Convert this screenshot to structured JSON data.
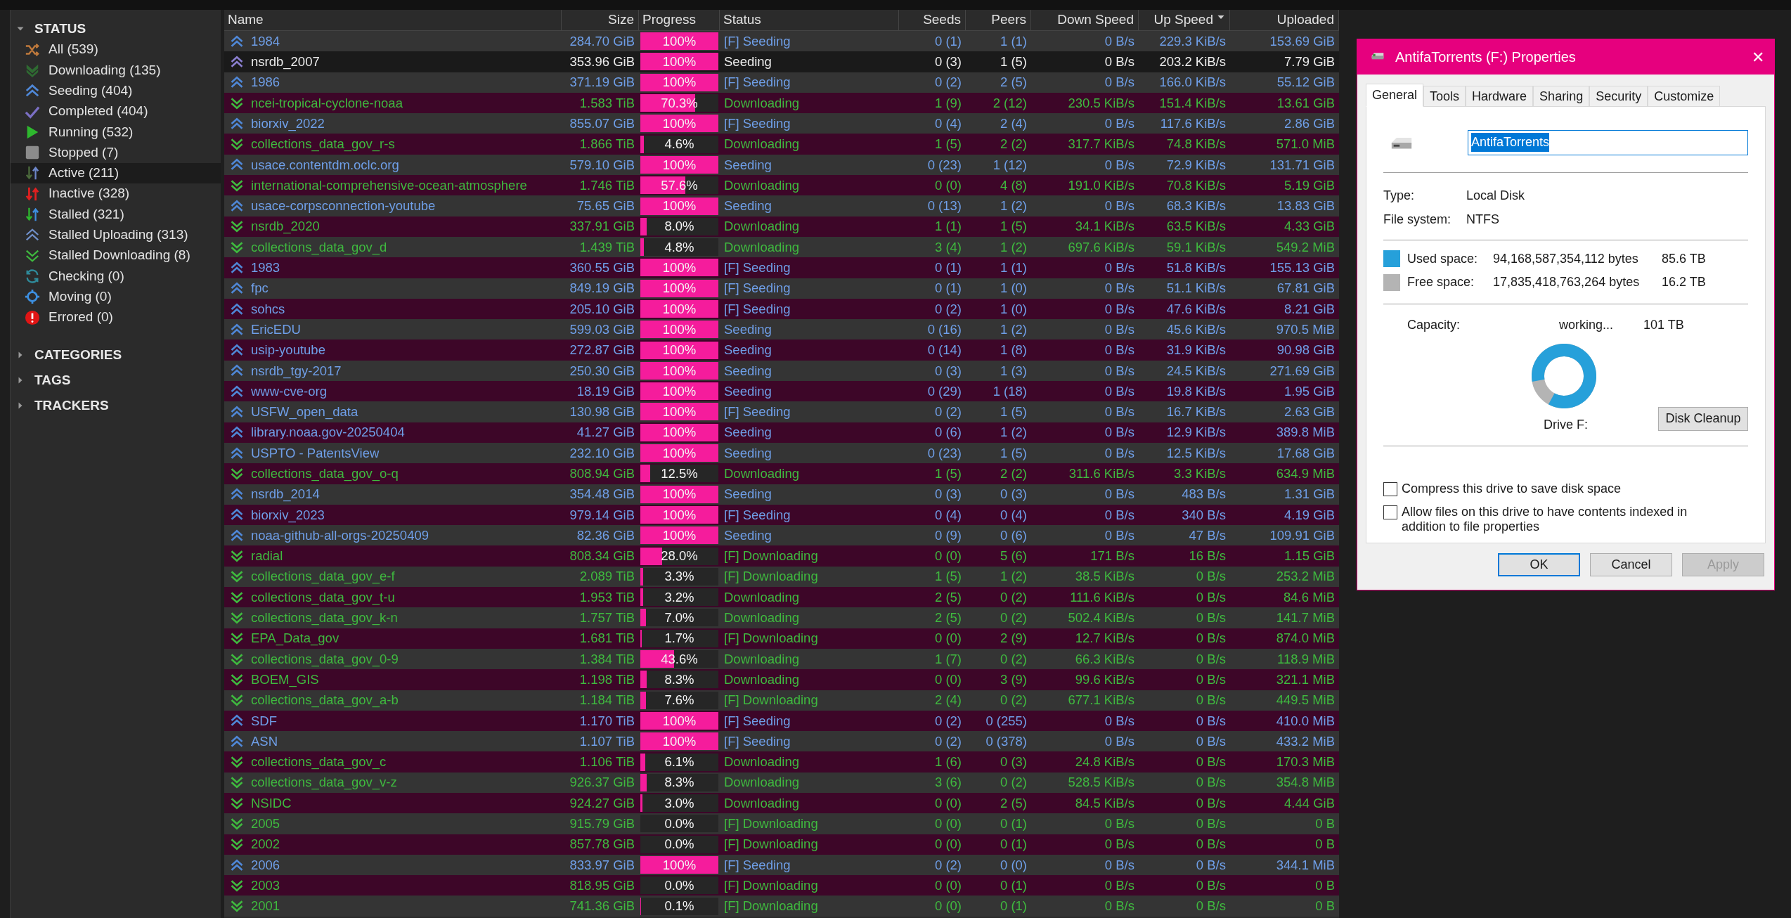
{
  "sidebar": {
    "sections": [
      {
        "label": "STATUS",
        "expanded": true,
        "items": [
          {
            "kind": "all",
            "label": "All (539)",
            "selected": false
          },
          {
            "kind": "downloading",
            "label": "Downloading (135)",
            "selected": false
          },
          {
            "kind": "seeding",
            "label": "Seeding (404)",
            "selected": false
          },
          {
            "kind": "completed",
            "label": "Completed (404)",
            "selected": false
          },
          {
            "kind": "running",
            "label": "Running (532)",
            "selected": false
          },
          {
            "kind": "stopped",
            "label": "Stopped (7)",
            "selected": false
          },
          {
            "kind": "active",
            "label": "Active (211)",
            "selected": true
          },
          {
            "kind": "inactive",
            "label": "Inactive (328)",
            "selected": false
          },
          {
            "kind": "stalled",
            "label": "Stalled (321)",
            "selected": false
          },
          {
            "kind": "stalled-uploading",
            "label": "Stalled Uploading (313)",
            "selected": false
          },
          {
            "kind": "stalled-downloading",
            "label": "Stalled Downloading (8)",
            "selected": false
          },
          {
            "kind": "checking",
            "label": "Checking (0)",
            "selected": false
          },
          {
            "kind": "moving",
            "label": "Moving (0)",
            "selected": false
          },
          {
            "kind": "errored",
            "label": "Errored (0)",
            "selected": false
          }
        ]
      },
      {
        "label": "CATEGORIES",
        "expanded": false
      },
      {
        "label": "TAGS",
        "expanded": false
      },
      {
        "label": "TRACKERS",
        "expanded": false
      }
    ]
  },
  "table": {
    "columns": [
      {
        "label": "Name",
        "sorted": false
      },
      {
        "label": "Size",
        "sorted": false
      },
      {
        "label": "Progress",
        "sorted": false
      },
      {
        "label": "Status",
        "sorted": false
      },
      {
        "label": "Seeds",
        "sorted": false
      },
      {
        "label": "Peers",
        "sorted": false
      },
      {
        "label": "Down Speed",
        "sorted": false
      },
      {
        "label": "Up Speed",
        "sorted": true
      },
      {
        "label": "Uploaded",
        "sorted": false
      }
    ],
    "rows": [
      {
        "kind": "seeding",
        "selected": false,
        "name": "1984",
        "size": "284.70 GiB",
        "progress": "100%",
        "level": 1,
        "status": "[F] Seeding",
        "seeds": "0 (1)",
        "peers": "1 (1)",
        "down_speed": "0 B/s",
        "up_speed": "229.3 KiB/s",
        "uploaded": "153.69 GiB"
      },
      {
        "kind": "seeding",
        "selected": true,
        "name": "nsrdb_2007",
        "size": "353.96 GiB",
        "progress": "100%",
        "level": 1,
        "status": "Seeding",
        "seeds": "0 (3)",
        "peers": "1 (5)",
        "down_speed": "0 B/s",
        "up_speed": "203.2 KiB/s",
        "uploaded": "7.79 GiB"
      },
      {
        "kind": "seeding",
        "selected": false,
        "name": "1986",
        "size": "371.19 GiB",
        "progress": "100%",
        "level": 1,
        "status": "[F] Seeding",
        "seeds": "0 (2)",
        "peers": "2 (5)",
        "down_speed": "0 B/s",
        "up_speed": "166.0 KiB/s",
        "uploaded": "55.12 GiB"
      },
      {
        "kind": "downloading",
        "selected": false,
        "name": "ncei-tropical-cyclone-noaa",
        "size": "1.583 TiB",
        "progress": "70.3%",
        "level": 0.703,
        "status": "Downloading",
        "seeds": "1 (9)",
        "peers": "2 (12)",
        "down_speed": "230.5 KiB/s",
        "up_speed": "151.4 KiB/s",
        "uploaded": "13.61 GiB"
      },
      {
        "kind": "seeding",
        "selected": false,
        "name": "biorxiv_2022",
        "size": "855.07 GiB",
        "progress": "100%",
        "level": 1,
        "status": "[F] Seeding",
        "seeds": "0 (4)",
        "peers": "2 (4)",
        "down_speed": "0 B/s",
        "up_speed": "117.6 KiB/s",
        "uploaded": "2.86 GiB"
      },
      {
        "kind": "downloading",
        "selected": false,
        "name": "collections_data_gov_r-s",
        "size": "1.866 TiB",
        "progress": "4.6%",
        "level": 0.046,
        "status": "Downloading",
        "seeds": "1 (5)",
        "peers": "2 (2)",
        "down_speed": "317.7 KiB/s",
        "up_speed": "74.8 KiB/s",
        "uploaded": "571.0 MiB"
      },
      {
        "kind": "seeding",
        "selected": false,
        "name": "usace.contentdm.oclc.org",
        "size": "579.10 GiB",
        "progress": "100%",
        "level": 1,
        "status": "Seeding",
        "seeds": "0 (23)",
        "peers": "1 (12)",
        "down_speed": "0 B/s",
        "up_speed": "72.9 KiB/s",
        "uploaded": "131.71 GiB"
      },
      {
        "kind": "downloading",
        "selected": false,
        "name": "international-comprehensive-ocean-atmosphere",
        "size": "1.746 TiB",
        "progress": "57.6%",
        "level": 0.576,
        "status": "Downloading",
        "seeds": "0 (0)",
        "peers": "4 (8)",
        "down_speed": "191.0 KiB/s",
        "up_speed": "70.8 KiB/s",
        "uploaded": "5.19 GiB"
      },
      {
        "kind": "seeding",
        "selected": false,
        "name": "usace-corpsconnection-youtube",
        "size": "75.65 GiB",
        "progress": "100%",
        "level": 1,
        "status": "Seeding",
        "seeds": "0 (13)",
        "peers": "1 (2)",
        "down_speed": "0 B/s",
        "up_speed": "68.3 KiB/s",
        "uploaded": "13.83 GiB"
      },
      {
        "kind": "downloading",
        "selected": false,
        "name": "nsrdb_2020",
        "size": "337.91 GiB",
        "progress": "8.0%",
        "level": 0.08,
        "status": "Downloading",
        "seeds": "1 (1)",
        "peers": "1 (5)",
        "down_speed": "34.1 KiB/s",
        "up_speed": "63.5 KiB/s",
        "uploaded": "4.33 GiB"
      },
      {
        "kind": "downloading",
        "selected": false,
        "name": "collections_data_gov_d",
        "size": "1.439 TiB",
        "progress": "4.8%",
        "level": 0.048,
        "status": "Downloading",
        "seeds": "3 (4)",
        "peers": "1 (2)",
        "down_speed": "697.6 KiB/s",
        "up_speed": "59.1 KiB/s",
        "uploaded": "549.2 MiB"
      },
      {
        "kind": "seeding",
        "selected": false,
        "name": "1983",
        "size": "360.55 GiB",
        "progress": "100%",
        "level": 1,
        "status": "[F] Seeding",
        "seeds": "0 (1)",
        "peers": "1 (1)",
        "down_speed": "0 B/s",
        "up_speed": "51.8 KiB/s",
        "uploaded": "155.13 GiB"
      },
      {
        "kind": "seeding",
        "selected": false,
        "name": "fpc",
        "size": "849.19 GiB",
        "progress": "100%",
        "level": 1,
        "status": "[F] Seeding",
        "seeds": "0 (1)",
        "peers": "1 (0)",
        "down_speed": "0 B/s",
        "up_speed": "51.1 KiB/s",
        "uploaded": "67.81 GiB"
      },
      {
        "kind": "seeding",
        "selected": false,
        "name": "sohcs",
        "size": "205.10 GiB",
        "progress": "100%",
        "level": 1,
        "status": "[F] Seeding",
        "seeds": "0 (2)",
        "peers": "1 (0)",
        "down_speed": "0 B/s",
        "up_speed": "47.6 KiB/s",
        "uploaded": "8.21 GiB"
      },
      {
        "kind": "seeding",
        "selected": false,
        "name": "EricEDU",
        "size": "599.03 GiB",
        "progress": "100%",
        "level": 1,
        "status": "Seeding",
        "seeds": "0 (16)",
        "peers": "1 (2)",
        "down_speed": "0 B/s",
        "up_speed": "45.6 KiB/s",
        "uploaded": "970.5 MiB"
      },
      {
        "kind": "seeding",
        "selected": false,
        "name": "usip-youtube",
        "size": "272.87 GiB",
        "progress": "100%",
        "level": 1,
        "status": "Seeding",
        "seeds": "0 (14)",
        "peers": "1 (8)",
        "down_speed": "0 B/s",
        "up_speed": "31.9 KiB/s",
        "uploaded": "90.98 GiB"
      },
      {
        "kind": "seeding",
        "selected": false,
        "name": "nsrdb_tgy-2017",
        "size": "250.30 GiB",
        "progress": "100%",
        "level": 1,
        "status": "Seeding",
        "seeds": "0 (3)",
        "peers": "1 (3)",
        "down_speed": "0 B/s",
        "up_speed": "24.5 KiB/s",
        "uploaded": "271.69 GiB"
      },
      {
        "kind": "seeding",
        "selected": false,
        "name": "www-cve-org",
        "size": "18.19 GiB",
        "progress": "100%",
        "level": 1,
        "status": "Seeding",
        "seeds": "0 (29)",
        "peers": "1 (18)",
        "down_speed": "0 B/s",
        "up_speed": "19.8 KiB/s",
        "uploaded": "1.95 GiB"
      },
      {
        "kind": "seeding",
        "selected": false,
        "name": "USFW_open_data",
        "size": "130.98 GiB",
        "progress": "100%",
        "level": 1,
        "status": "[F] Seeding",
        "seeds": "0 (2)",
        "peers": "1 (5)",
        "down_speed": "0 B/s",
        "up_speed": "16.7 KiB/s",
        "uploaded": "2.63 GiB"
      },
      {
        "kind": "seeding",
        "selected": false,
        "name": "library.noaa.gov-20250404",
        "size": "41.27 GiB",
        "progress": "100%",
        "level": 1,
        "status": "Seeding",
        "seeds": "0 (6)",
        "peers": "1 (2)",
        "down_speed": "0 B/s",
        "up_speed": "12.9 KiB/s",
        "uploaded": "389.8 MiB"
      },
      {
        "kind": "seeding",
        "selected": false,
        "name": "USPTO - PatentsView",
        "size": "232.10 GiB",
        "progress": "100%",
        "level": 1,
        "status": "Seeding",
        "seeds": "0 (23)",
        "peers": "1 (5)",
        "down_speed": "0 B/s",
        "up_speed": "12.5 KiB/s",
        "uploaded": "17.68 GiB"
      },
      {
        "kind": "downloading",
        "selected": false,
        "name": "collections_data_gov_o-q",
        "size": "808.94 GiB",
        "progress": "12.5%",
        "level": 0.125,
        "status": "Downloading",
        "seeds": "1 (5)",
        "peers": "2 (2)",
        "down_speed": "311.6 KiB/s",
        "up_speed": "3.3 KiB/s",
        "uploaded": "634.9 MiB"
      },
      {
        "kind": "seeding",
        "selected": false,
        "name": "nsrdb_2014",
        "size": "354.48 GiB",
        "progress": "100%",
        "level": 1,
        "status": "Seeding",
        "seeds": "0 (3)",
        "peers": "0 (3)",
        "down_speed": "0 B/s",
        "up_speed": "483 B/s",
        "uploaded": "1.31 GiB"
      },
      {
        "kind": "seeding",
        "selected": false,
        "name": "biorxiv_2023",
        "size": "979.14 GiB",
        "progress": "100%",
        "level": 1,
        "status": "[F] Seeding",
        "seeds": "0 (4)",
        "peers": "0 (4)",
        "down_speed": "0 B/s",
        "up_speed": "340 B/s",
        "uploaded": "4.19 GiB"
      },
      {
        "kind": "seeding",
        "selected": false,
        "name": "noaa-github-all-orgs-20250409",
        "size": "82.36 GiB",
        "progress": "100%",
        "level": 1,
        "status": "Seeding",
        "seeds": "0 (9)",
        "peers": "0 (6)",
        "down_speed": "0 B/s",
        "up_speed": "47 B/s",
        "uploaded": "109.91 GiB"
      },
      {
        "kind": "downloading",
        "selected": false,
        "name": "radial",
        "size": "808.34 GiB",
        "progress": "28.0%",
        "level": 0.28,
        "status": "[F] Downloading",
        "seeds": "0 (0)",
        "peers": "5 (6)",
        "down_speed": "171 B/s",
        "up_speed": "16 B/s",
        "uploaded": "1.15 GiB"
      },
      {
        "kind": "downloading",
        "selected": false,
        "name": "collections_data_gov_e-f",
        "size": "2.089 TiB",
        "progress": "3.3%",
        "level": 0.033,
        "status": "[F] Downloading",
        "seeds": "1 (5)",
        "peers": "1 (2)",
        "down_speed": "38.5 KiB/s",
        "up_speed": "0 B/s",
        "uploaded": "253.2 MiB"
      },
      {
        "kind": "downloading",
        "selected": false,
        "name": "collections_data_gov_t-u",
        "size": "1.953 TiB",
        "progress": "3.2%",
        "level": 0.032,
        "status": "Downloading",
        "seeds": "2 (5)",
        "peers": "0 (2)",
        "down_speed": "111.6 KiB/s",
        "up_speed": "0 B/s",
        "uploaded": "84.6 MiB"
      },
      {
        "kind": "downloading",
        "selected": false,
        "name": "collections_data_gov_k-n",
        "size": "1.757 TiB",
        "progress": "7.0%",
        "level": 0.07,
        "status": "Downloading",
        "seeds": "2 (5)",
        "peers": "0 (2)",
        "down_speed": "502.4 KiB/s",
        "up_speed": "0 B/s",
        "uploaded": "141.7 MiB"
      },
      {
        "kind": "downloading",
        "selected": false,
        "name": "EPA_Data_gov",
        "size": "1.681 TiB",
        "progress": "1.7%",
        "level": 0.017,
        "status": "[F] Downloading",
        "seeds": "0 (0)",
        "peers": "2 (9)",
        "down_speed": "12.7 KiB/s",
        "up_speed": "0 B/s",
        "uploaded": "874.0 MiB"
      },
      {
        "kind": "downloading",
        "selected": false,
        "name": "collections_data_gov_0-9",
        "size": "1.384 TiB",
        "progress": "43.6%",
        "level": 0.436,
        "status": "Downloading",
        "seeds": "1 (7)",
        "peers": "0 (2)",
        "down_speed": "66.3 KiB/s",
        "up_speed": "0 B/s",
        "uploaded": "118.9 MiB"
      },
      {
        "kind": "downloading",
        "selected": false,
        "name": "BOEM_GIS",
        "size": "1.198 TiB",
        "progress": "8.3%",
        "level": 0.083,
        "status": "Downloading",
        "seeds": "0 (0)",
        "peers": "3 (9)",
        "down_speed": "99.6 KiB/s",
        "up_speed": "0 B/s",
        "uploaded": "321.1 MiB"
      },
      {
        "kind": "downloading",
        "selected": false,
        "name": "collections_data_gov_a-b",
        "size": "1.184 TiB",
        "progress": "7.6%",
        "level": 0.076,
        "status": "[F] Downloading",
        "seeds": "2 (4)",
        "peers": "0 (2)",
        "down_speed": "677.1 KiB/s",
        "up_speed": "0 B/s",
        "uploaded": "449.5 MiB"
      },
      {
        "kind": "seeding",
        "selected": false,
        "name": "SDF",
        "size": "1.170 TiB",
        "progress": "100%",
        "level": 1,
        "status": "[F] Seeding",
        "seeds": "0 (2)",
        "peers": "0 (255)",
        "down_speed": "0 B/s",
        "up_speed": "0 B/s",
        "uploaded": "410.0 MiB"
      },
      {
        "kind": "seeding",
        "selected": false,
        "name": "ASN",
        "size": "1.107 TiB",
        "progress": "100%",
        "level": 1,
        "status": "[F] Seeding",
        "seeds": "0 (2)",
        "peers": "0 (378)",
        "down_speed": "0 B/s",
        "up_speed": "0 B/s",
        "uploaded": "433.2 MiB"
      },
      {
        "kind": "downloading",
        "selected": false,
        "name": "collections_data_gov_c",
        "size": "1.106 TiB",
        "progress": "6.1%",
        "level": 0.061,
        "status": "Downloading",
        "seeds": "1 (6)",
        "peers": "0 (3)",
        "down_speed": "24.8 KiB/s",
        "up_speed": "0 B/s",
        "uploaded": "170.3 MiB"
      },
      {
        "kind": "downloading",
        "selected": false,
        "name": "collections_data_gov_v-z",
        "size": "926.37 GiB",
        "progress": "8.3%",
        "level": 0.083,
        "status": "Downloading",
        "seeds": "3 (6)",
        "peers": "0 (2)",
        "down_speed": "528.5 KiB/s",
        "up_speed": "0 B/s",
        "uploaded": "354.8 MiB"
      },
      {
        "kind": "downloading",
        "selected": false,
        "name": "NSIDC",
        "size": "924.27 GiB",
        "progress": "3.0%",
        "level": 0.03,
        "status": "Downloading",
        "seeds": "0 (0)",
        "peers": "2 (5)",
        "down_speed": "84.5 KiB/s",
        "up_speed": "0 B/s",
        "uploaded": "4.44 GiB"
      },
      {
        "kind": "downloading",
        "selected": false,
        "name": "2005",
        "size": "915.79 GiB",
        "progress": "0.0%",
        "level": 0,
        "status": "[F] Downloading",
        "seeds": "0 (0)",
        "peers": "0 (1)",
        "down_speed": "0 B/s",
        "up_speed": "0 B/s",
        "uploaded": "0 B"
      },
      {
        "kind": "downloading",
        "selected": false,
        "name": "2002",
        "size": "857.78 GiB",
        "progress": "0.0%",
        "level": 0,
        "status": "[F] Downloading",
        "seeds": "0 (0)",
        "peers": "0 (1)",
        "down_speed": "0 B/s",
        "up_speed": "0 B/s",
        "uploaded": "0 B"
      },
      {
        "kind": "seeding",
        "selected": false,
        "name": "2006",
        "size": "833.97 GiB",
        "progress": "100%",
        "level": 1,
        "status": "[F] Seeding",
        "seeds": "0 (2)",
        "peers": "0 (0)",
        "down_speed": "0 B/s",
        "up_speed": "0 B/s",
        "uploaded": "344.1 MiB"
      },
      {
        "kind": "downloading",
        "selected": false,
        "name": "2003",
        "size": "818.95 GiB",
        "progress": "0.0%",
        "level": 0,
        "status": "[F] Downloading",
        "seeds": "0 (0)",
        "peers": "0 (1)",
        "down_speed": "0 B/s",
        "up_speed": "0 B/s",
        "uploaded": "0 B"
      },
      {
        "kind": "downloading",
        "selected": false,
        "name": "2001",
        "size": "741.36 GiB",
        "progress": "0.1%",
        "level": 0.001,
        "status": "[F] Downloading",
        "seeds": "0 (0)",
        "peers": "0 (1)",
        "down_speed": "0 B/s",
        "up_speed": "0 B/s",
        "uploaded": "0 B"
      }
    ]
  },
  "dialog": {
    "title": "AntifaTorrents (F:) Properties",
    "close": "✕",
    "tabs": [
      {
        "label": "General",
        "selected": true
      },
      {
        "label": "Tools",
        "selected": false
      },
      {
        "label": "Hardware",
        "selected": false
      },
      {
        "label": "Sharing",
        "selected": false
      },
      {
        "label": "Security",
        "selected": false
      },
      {
        "label": "Customize",
        "selected": false
      }
    ],
    "name_field": "AntifaTorrents",
    "info": [
      {
        "label": "Type:",
        "value": "Local Disk"
      },
      {
        "label": "File system:",
        "value": "NTFS"
      }
    ],
    "space": [
      {
        "label": "Used space:",
        "bytes": "94,168,587,354,112 bytes",
        "size": "85.6 TB",
        "color": "#26a0da"
      },
      {
        "label": "Free space:",
        "bytes": "17,835,418,763,264 bytes",
        "size": "16.2 TB",
        "color": "#b4b4b4"
      }
    ],
    "capacity": {
      "label": "Capacity:",
      "bytes": "working...",
      "size": "101 TB"
    },
    "drive_label": "Drive F:",
    "cleanup_button": "Disk Cleanup",
    "options": [
      {
        "label": "Compress this drive to save disk space",
        "checked": false
      },
      {
        "label": "Allow files on this drive to have contents indexed in addition to file properties",
        "checked": false
      }
    ],
    "buttons": [
      {
        "label": "OK",
        "kind": "default",
        "disabled": false
      },
      {
        "label": "Cancel",
        "kind": "normal",
        "disabled": false
      },
      {
        "label": "Apply",
        "kind": "normal",
        "disabled": true
      }
    ]
  }
}
